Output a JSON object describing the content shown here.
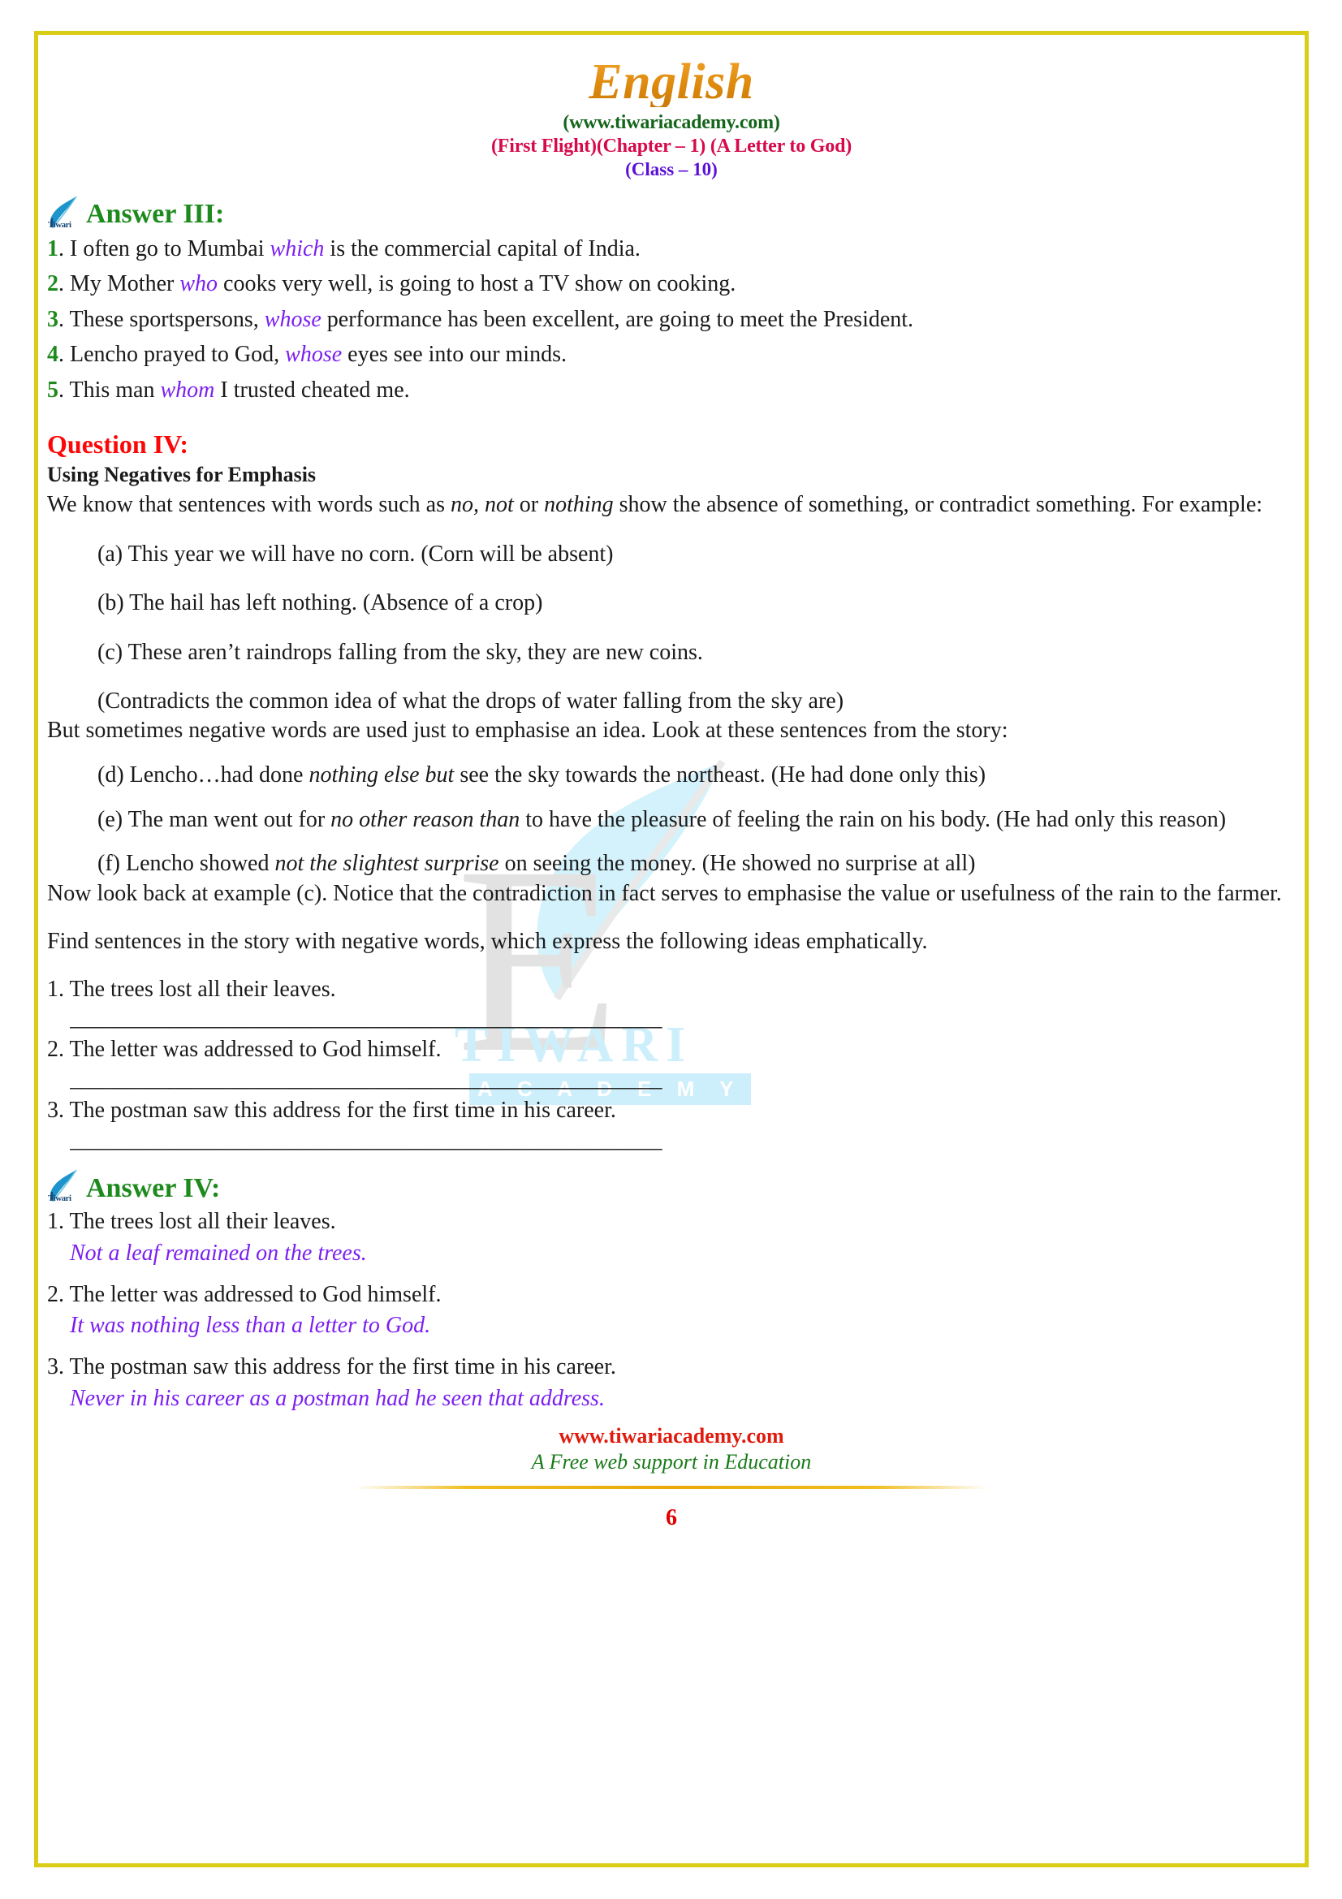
{
  "header": {
    "title": "English",
    "site": "(www.tiwariacademy.com)",
    "chapter": "(First Flight)(Chapter – 1) (A Letter to God)",
    "class": "(Class – 10)"
  },
  "watermark": {
    "letter": "E",
    "brand": "TIWARI",
    "sub": "A C A D E M Y",
    "leaf_icon": "leaf-icon"
  },
  "answer3": {
    "heading": "Answer III:",
    "icon": "tiwari-leaf-icon",
    "icon_word": "Tiwari",
    "items": [
      {
        "num": "1",
        "pre": ". I often go to Mumbai ",
        "rel": "which",
        "post": " is the commercial capital of India."
      },
      {
        "num": "2",
        "pre": ". My Mother ",
        "rel": "who",
        "post": " cooks very well, is going to host a TV show on cooking."
      },
      {
        "num": "3",
        "pre": ". These sportspersons, ",
        "rel": "whose",
        "post": " performance has been excellent, are going to meet the President."
      },
      {
        "num": "4",
        "pre": ". Lencho prayed to God, ",
        "rel": "whose",
        "post": " eyes see into our minds."
      },
      {
        "num": "5",
        "pre": ". This man ",
        "rel": "whom",
        "post": " I trusted cheated me."
      }
    ]
  },
  "question4": {
    "heading": "Question IV:",
    "subheading": "Using Negatives for Emphasis",
    "intro_1": "We know that sentences with words such as ",
    "intro_italic_1": "no, not",
    "intro_2": " or ",
    "intro_italic_2": "nothing",
    "intro_3": " show the absence of something, or contradict something. For example:",
    "example_a": "(a) This year we will have no corn. (Corn will be absent)",
    "example_b": "(b) The hail has left nothing. (Absence of a crop)",
    "example_c": "(c) These aren’t raindrops falling from the sky, they are new coins.",
    "contradicts_note": "(Contradicts the common idea of what the drops of water falling from the sky are)",
    "but_sometimes": "But sometimes negative words are used just to emphasise an idea. Look at these sentences from the story:",
    "example_d_pre": "(d) Lencho…had done ",
    "example_d_italic": "nothing else but",
    "example_d_post": " see the sky towards the northeast. (He had done only this)",
    "example_e_pre": "(e) The man went out for ",
    "example_e_italic": "no other reason than",
    "example_e_post": " to have the pleasure of feeling the rain on his body. (He had only this reason)",
    "example_f_pre": "(f) Lencho showed ",
    "example_f_italic": "not the slightest surprise",
    "example_f_post": " on seeing the money. (He showed no surprise at all)",
    "now_look_back": "Now look back at example (c). Notice that the contradiction in fact serves to emphasise the value or usefulness of the rain to the farmer.",
    "find_sentences": "Find sentences in the story with negative words, which express the following ideas emphatically.",
    "prompts": [
      "1. The trees lost all their leaves.",
      "2. The letter was addressed to God himself.",
      "3. The postman saw this address for the first time in his career."
    ],
    "blank": "______________________________________________________"
  },
  "answer4": {
    "heading": "Answer IV:",
    "icon": "tiwari-leaf-icon",
    "icon_word": "Tiwari",
    "items": [
      {
        "prompt": "1. The trees lost all their leaves.",
        "response": "Not a leaf remained on the trees."
      },
      {
        "prompt": "2. The letter was addressed to God himself.",
        "response": "It was nothing less than a letter to God."
      },
      {
        "prompt": "3. The postman saw this address for the first time in his career.",
        "response": "Never in his career as a postman had he seen that address."
      }
    ]
  },
  "footer": {
    "site": "www.tiwariacademy.com",
    "tagline": "A Free web support in Education",
    "page_number": "6"
  },
  "colors": {
    "border": "#d9cd17",
    "title": "#e28a16",
    "site_green": "#14651a",
    "chapter_pink": "#d60a4b",
    "class_purple": "#5b0fd6",
    "answer_green": "#1e8a1e",
    "question_red": "#fb0707",
    "relative_purple": "#7b1ff0",
    "footer_red": "#e01b0e",
    "footer_green": "#1a7a1a",
    "page_num_red": "#e00000"
  }
}
